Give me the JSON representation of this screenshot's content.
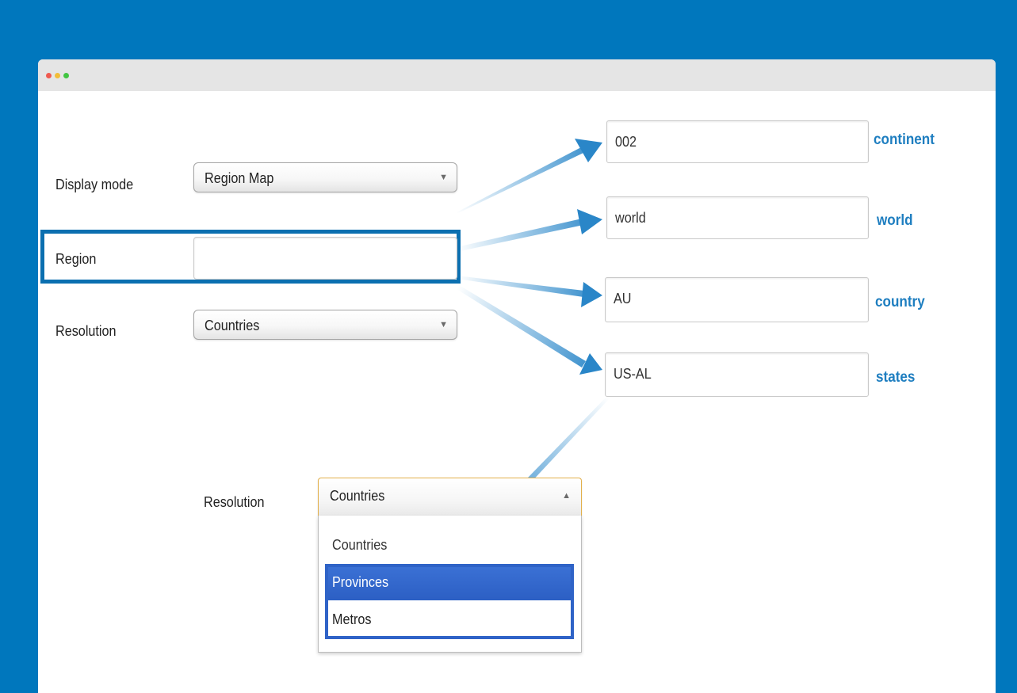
{
  "form": {
    "display_mode": {
      "label": "Display mode",
      "value": "Region Map"
    },
    "region": {
      "label": "Region",
      "value": ""
    },
    "resolution": {
      "label": "Resolution",
      "value": "Countries"
    }
  },
  "examples": [
    {
      "value": "002",
      "tag": "continent"
    },
    {
      "value": "world",
      "tag": "world"
    },
    {
      "value": "AU",
      "tag": "country"
    },
    {
      "value": "US-AL",
      "tag": "states"
    }
  ],
  "resolution_dropdown": {
    "label": "Resolution",
    "value": "Countries",
    "options": [
      "Countries",
      "Provinces",
      "Metros"
    ],
    "highlighted": "Provinces"
  },
  "colors": {
    "background": "#0077bd",
    "accent": "#1e7ec0",
    "selection": "#2f63c7"
  },
  "icons": {
    "select_caret": "triangle-down",
    "open_caret": "triangle-up",
    "arrows": "gradient-arrows"
  }
}
